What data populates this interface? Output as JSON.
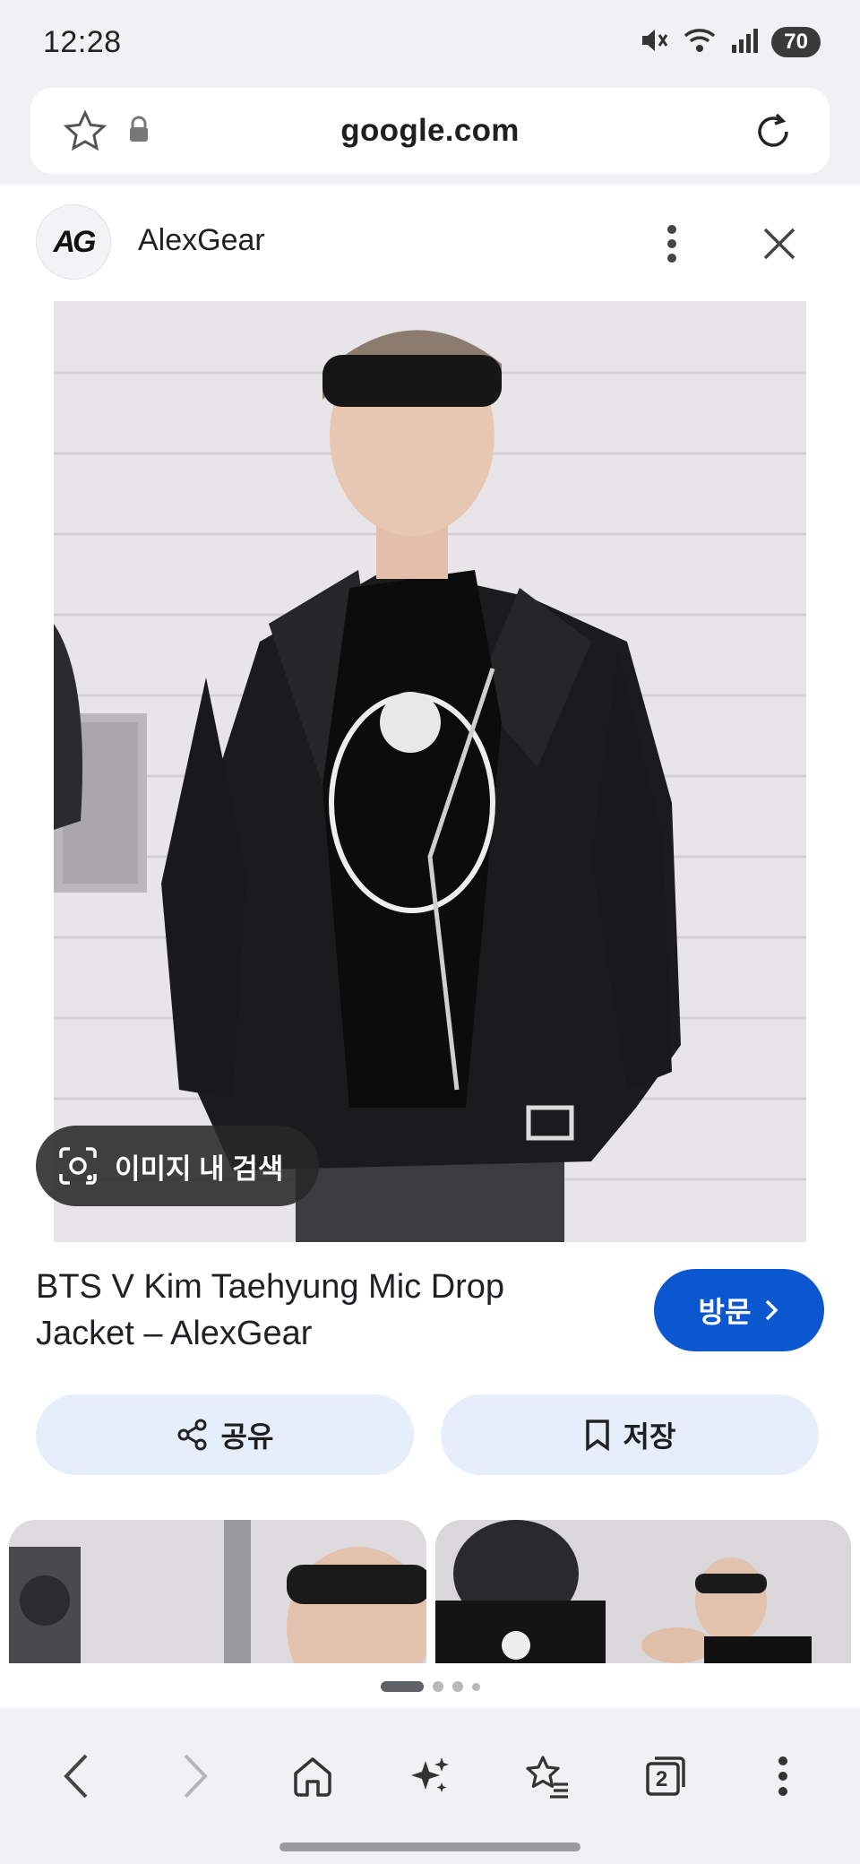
{
  "status_bar": {
    "time": "12:28",
    "battery": "70"
  },
  "address_bar": {
    "url": "google.com"
  },
  "panel": {
    "site_logo_text": "AG",
    "site_name": "AlexGear",
    "lens_label": "이미지 내 검색",
    "title": "BTS V Kim Taehyung Mic Drop Jacket – AlexGear",
    "visit_label": "방문",
    "share_label": "공유",
    "save_label": "저장"
  },
  "bottom_nav": {
    "tab_count": "2"
  },
  "colors": {
    "accent": "#0b57d0",
    "action_bg": "#e6eefc"
  }
}
